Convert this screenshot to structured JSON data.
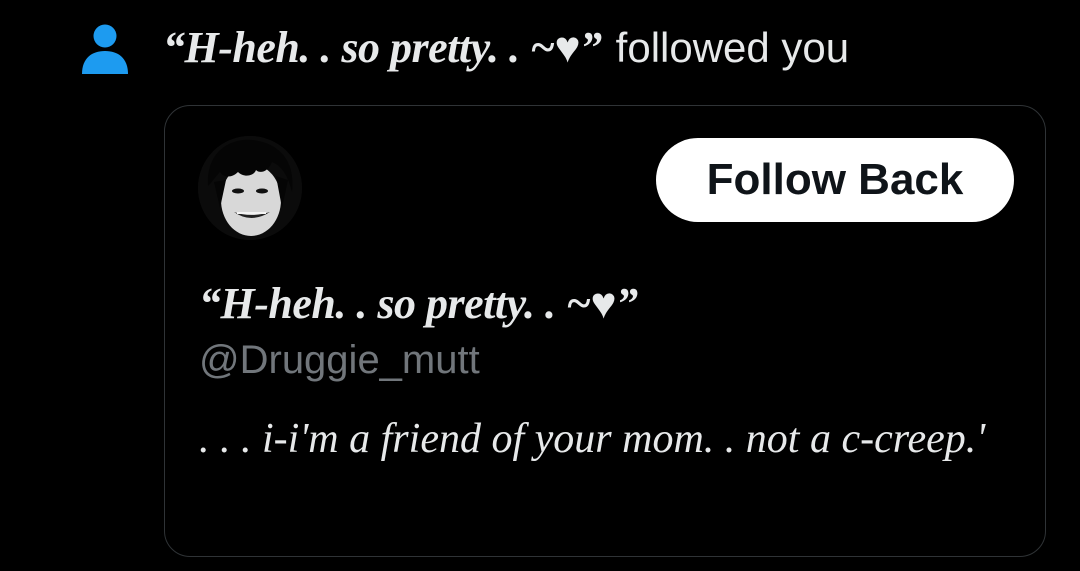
{
  "notification": {
    "icon": "person-icon",
    "icon_color": "#1d9bf0",
    "display_name": "“H-heh. . so pretty. . ~♥”",
    "action_text": "followed you"
  },
  "card": {
    "avatar_icon": "profile-avatar",
    "follow_button_label": "Follow Back",
    "display_name": "“H-heh. . so pretty. . ~♥”",
    "handle": "@Druggie_mutt",
    "bio": ".  .  . i-i'm a friend of your mom. . not a c-creep.'"
  },
  "colors": {
    "background": "#000000",
    "text_primary": "#e7e9ea",
    "text_secondary": "#71767b",
    "border": "#2f3336",
    "button_bg": "#ffffff",
    "button_text": "#0f1419"
  }
}
